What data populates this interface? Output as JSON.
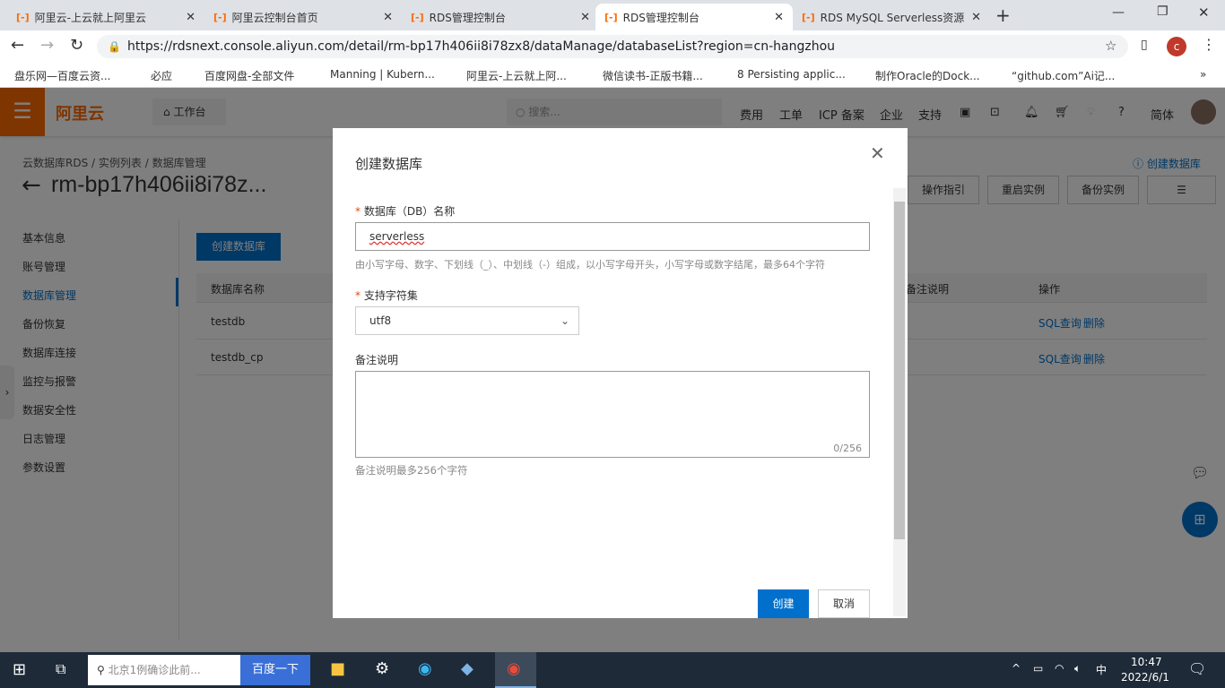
{
  "browser": {
    "tabs": [
      {
        "title": "阿里云-上云就上阿里云"
      },
      {
        "title": "阿里云控制台首页"
      },
      {
        "title": "RDS管理控制台"
      },
      {
        "title": "RDS管理控制台",
        "active": true
      },
      {
        "title": "RDS MySQL Serverless资源"
      }
    ],
    "url": "https://rdsnext.console.aliyun.com/detail/rm-bp17h406ii8i78zx8/dataManage/databaseList?region=cn-hangzhou",
    "profile": "c",
    "bookmarks": [
      "盘乐网—百度云资...",
      "必应",
      "百度网盘-全部文件",
      "Manning | Kubern...",
      "阿里云-上云就上阿...",
      "微信读书-正版书籍...",
      "8 Persisting applic...",
      "制作Oracle的Dock...",
      "“github.com”Ai记..."
    ]
  },
  "header": {
    "logo": "阿里云",
    "workbench": "工作台",
    "search_placeholder": "搜索...",
    "nav": [
      "费用",
      "工单",
      "ICP 备案",
      "企业",
      "支持"
    ],
    "lang": "简体"
  },
  "breadcrumb": [
    "云数据库RDS",
    "实例列表",
    "数据库管理"
  ],
  "instance_title": "rm-bp17h406ii8i78z...",
  "help_link": "创建数据库",
  "actions": [
    "操作指引",
    "重启实例",
    "备份实例"
  ],
  "sidebar": {
    "items": [
      "基本信息",
      "账号管理",
      "数据库管理",
      "备份恢复",
      "数据库连接",
      "监控与报警",
      "数据安全性",
      "日志管理",
      "参数设置"
    ],
    "active": 2
  },
  "create_button": "创建数据库",
  "table": {
    "columns": [
      "数据库名称",
      "备注说明",
      "操作"
    ],
    "rows": [
      {
        "name": "testdb",
        "ops": [
          "SQL查询",
          "删除"
        ]
      },
      {
        "name": "testdb_cp",
        "ops": [
          "SQL查询",
          "删除"
        ]
      }
    ]
  },
  "modal": {
    "title": "创建数据库",
    "name_label": "数据库（DB）名称",
    "name_value": "serverless",
    "name_help": "由小写字母、数字、下划线（_）、中划线（-）组成，以小写字母开头，小写字母或数字结尾，最多64个字符",
    "charset_label": "支持字符集",
    "charset_value": "utf8",
    "remark_label": "备注说明",
    "remark_value": "",
    "remark_count": "0/256",
    "remark_help": "备注说明最多256个字符",
    "submit": "创建",
    "cancel": "取消"
  },
  "taskbar": {
    "search_placeholder": "北京1例确诊此前...",
    "search_button": "百度一下",
    "ime": "中",
    "time": "10:47",
    "date": "2022/6/1"
  },
  "colors": {
    "brand": "#ff6a00",
    "primary": "#0070cc"
  }
}
